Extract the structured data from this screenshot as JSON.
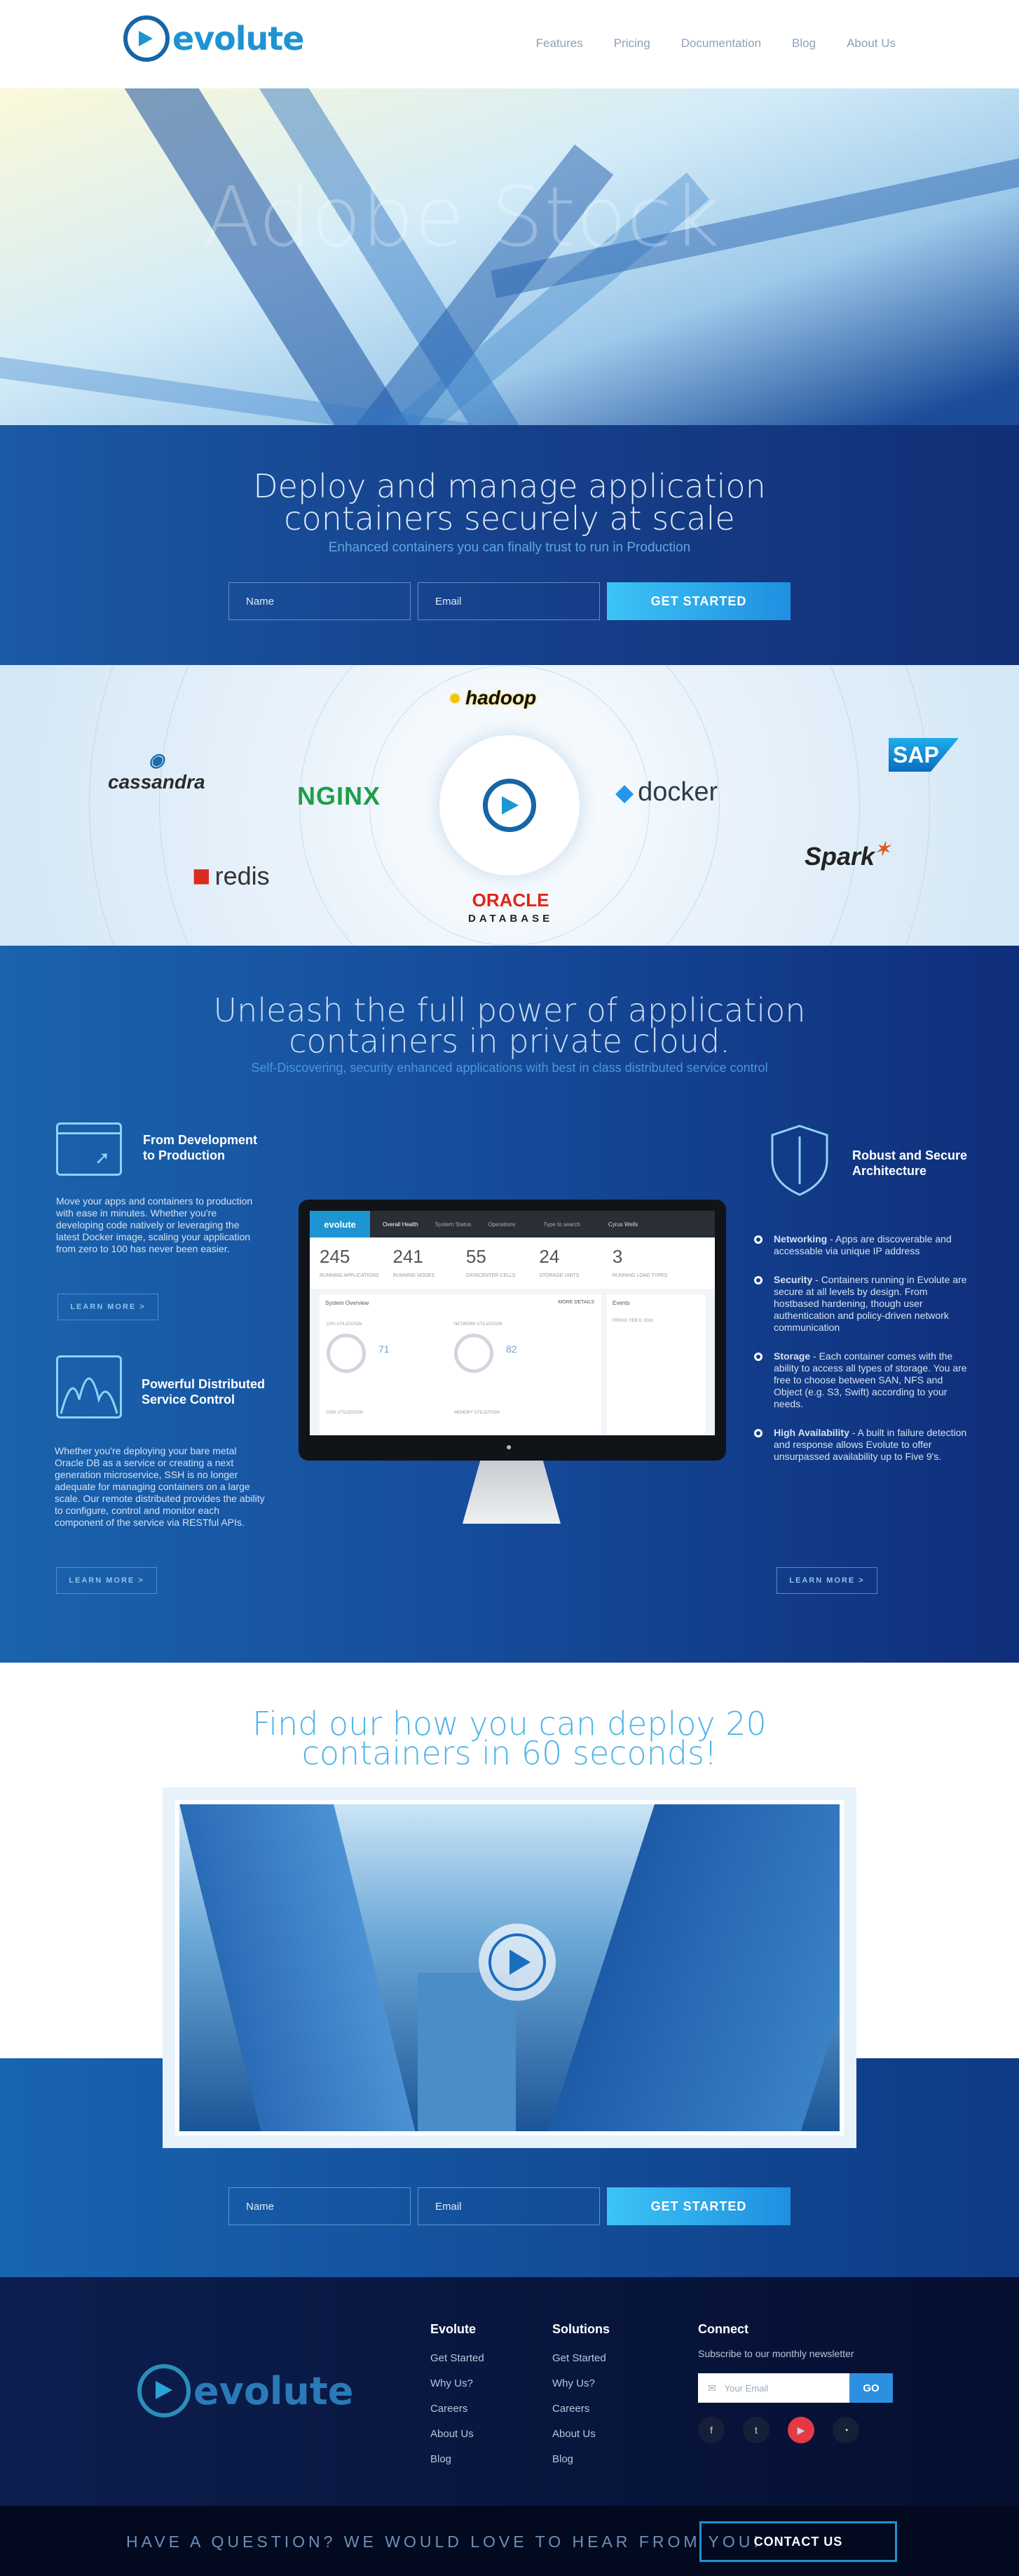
{
  "nav": {
    "logo_text": "evolute",
    "links": [
      "Features",
      "Pricing",
      "Documentation",
      "Blog",
      "About Us"
    ]
  },
  "hero": {
    "watermark": "Adobe Stock",
    "title_line1": "Deploy and manage application",
    "title_line2": "containers securely at scale",
    "subtitle": "Enhanced containers you can finally trust to run in Production",
    "form": {
      "name_placeholder": "Name",
      "email_placeholder": "Email",
      "button": "GET STARTED"
    }
  },
  "partners": {
    "logos": [
      "hadoop",
      "cassandra",
      "NGINX",
      "docker",
      "SAP",
      "redis",
      "ORACLE",
      "DATABASE",
      "Spark"
    ]
  },
  "features": {
    "title_line1": "Unleash the full power of application",
    "title_line2": "containers in private cloud.",
    "subtitle": "Self-Discovering, security enhanced applications with best in class distributed service control",
    "left": [
      {
        "heading_line1": "From Development",
        "heading_line2": "to Production",
        "text": "Move your apps and containers to production with ease in minutes. Whether you're developing code natively or leveraging the latest Docker image, scaling your application from zero to 100 has never been easier.",
        "button": "LEARN MORE >"
      },
      {
        "heading_line1": "Powerful Distributed",
        "heading_line2": "Service Control",
        "text": "Whether you're deploying your bare metal Oracle DB as a service or creating a next generation microservice, SSH is no longer adequate for managing containers on a large scale. Our remote distributed provides the ability to configure, control and monitor each component of the service via RESTful APIs.",
        "button": "LEARN MORE >"
      }
    ],
    "right": {
      "heading_line1": "Robust and Secure",
      "heading_line2": "Architecture",
      "bullets": [
        {
          "title": "Networking",
          "text": " - Apps are discoverable and accessable via unique IP address"
        },
        {
          "title": "Security",
          "text": " - Containers running in Evolute are secure at all levels by design. From hostbased hardening, though user authentication and policy-driven network communication"
        },
        {
          "title": "Storage",
          "text": " - Each container comes with the ability to access all types of storage. You are free to choose between SAN, NFS and Object (e.g. S3, Swift) according to your needs."
        },
        {
          "title": "High Availability",
          "text": " - A built in failure detection and response allows Evolute to offer unsurpassed availability up to Five 9's."
        }
      ],
      "button": "LEARN MORE >"
    },
    "dashboard": {
      "brand": "evolute",
      "tabs": [
        "Overall Health",
        "System Status",
        "Operations",
        "Type to search"
      ],
      "user": "Cyrus Wells",
      "stats": [
        {
          "value": "245",
          "label": "RUNNING APPLICATIONS"
        },
        {
          "value": "241",
          "label": "RUNNING NODES"
        },
        {
          "value": "55",
          "label": "DATACENTER CELLS"
        },
        {
          "value": "24",
          "label": "STORAGE UNITS"
        },
        {
          "value": "3",
          "label": "RUNNING LOAD TYPES"
        }
      ],
      "overview": "System Overview",
      "more": "MORE DETAILS",
      "events": "Events",
      "cpu_label": "CPU UTILIZATION",
      "cpu_value": "71",
      "net_label": "NETWORK UTILIZATION",
      "net_value": "82",
      "disk_label": "DISK UTILIZATION",
      "mem_label": "MEMORY UTILIZATION",
      "event_date": "FRIDAY, FEB 8, 2016"
    }
  },
  "video": {
    "title_line1": "Find our how you can deploy 20",
    "title_line2": "containers in 60 seconds!",
    "form": {
      "name_placeholder": "Name",
      "email_placeholder": "Email",
      "button": "GET STARTED"
    }
  },
  "footer": {
    "logo_text": "evolute",
    "col1": {
      "title": "Evolute",
      "links": [
        "Get Started",
        "Why Us?",
        "Careers",
        "About Us",
        "Blog"
      ]
    },
    "col2": {
      "title": "Solutions",
      "links": [
        "Get Started",
        "Why Us?",
        "Careers",
        "About Us",
        "Blog"
      ]
    },
    "connect": {
      "title": "Connect",
      "text": "Subscribe to our monthly newsletter",
      "email_placeholder": "Your Email",
      "button": "GO",
      "social": [
        "facebook-icon",
        "twitter-icon",
        "youtube-icon",
        "rss-icon"
      ]
    }
  },
  "bottom": {
    "question": "HAVE A QUESTION? WE WOULD LOVE TO HEAR FROM YOU!",
    "contact": "CONTACT US"
  },
  "colors": {
    "brand": "#1f93d2",
    "navy": "#0f2e7a",
    "cta_start": "#3cc4f6",
    "youtube": "#e53946"
  }
}
